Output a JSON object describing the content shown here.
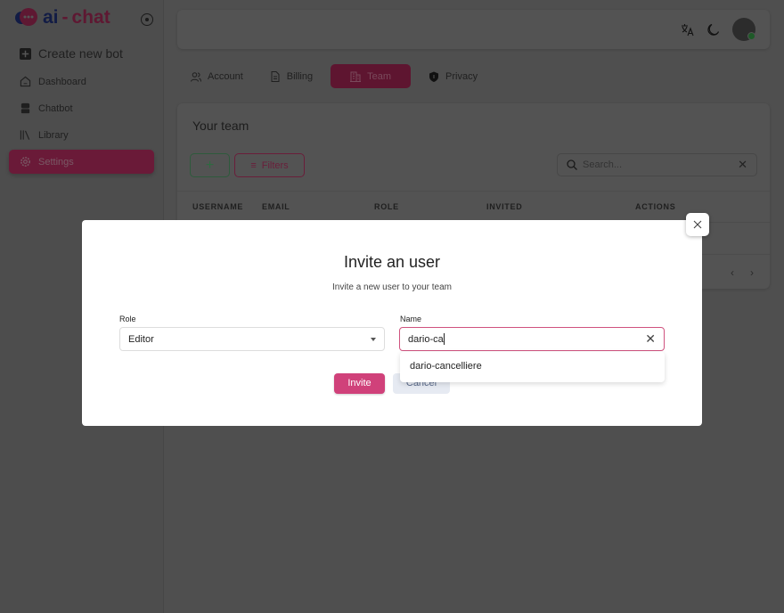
{
  "brand": {
    "ai": "ai",
    "chat": "chat",
    "dash": "-"
  },
  "sidebar": {
    "items": [
      {
        "label": "Create new bot",
        "icon": "plus-square-icon"
      },
      {
        "label": "Dashboard",
        "icon": "home-icon"
      },
      {
        "label": "Chatbot",
        "icon": "robot-icon"
      },
      {
        "label": "Library",
        "icon": "library-icon"
      },
      {
        "label": "Settings",
        "icon": "gear-icon",
        "active": true
      }
    ]
  },
  "tabs": [
    {
      "label": "Account"
    },
    {
      "label": "Billing"
    },
    {
      "label": "Team",
      "active": true
    },
    {
      "label": "Privacy"
    }
  ],
  "team": {
    "title": "Your team",
    "add_label": "+",
    "filters_label": "Filters",
    "search_placeholder": "Search...",
    "columns": [
      "USERNAME",
      "EMAIL",
      "ROLE",
      "INVITED",
      "ACTIONS"
    ]
  },
  "dialog": {
    "title": "Invite an user",
    "subtitle": "Invite a new user to your team",
    "role_label": "Role",
    "role_value": "Editor",
    "name_label": "Name",
    "name_value": "dario-ca",
    "suggestions": [
      "dario-cancelliere"
    ],
    "invite_label": "Invite",
    "cancel_label": "Cancel"
  },
  "colors": {
    "accent": "#a8234f",
    "invite": "#d0417a",
    "success": "#3c9a5a"
  }
}
